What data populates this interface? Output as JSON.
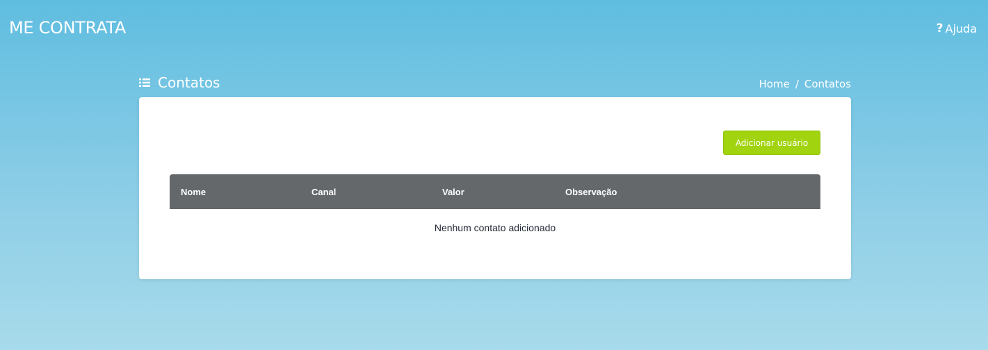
{
  "header": {
    "brand": "ME CONTRATA",
    "help_label": "Ajuda",
    "help_icon": "question-icon"
  },
  "page": {
    "title": "Contatos",
    "title_icon": "list-icon",
    "breadcrumb": [
      "Home",
      "Contatos"
    ],
    "breadcrumb_separator": "/"
  },
  "actions": {
    "add_label": "Adicionar usuário"
  },
  "table": {
    "columns": [
      "Nome",
      "Canal",
      "Valor",
      "Observação"
    ],
    "rows": [],
    "empty_message": "Nenhum contato adicionado"
  },
  "colors": {
    "background_top": "#5fbde0",
    "background_bottom": "#a8dbeb",
    "accent_button": "#a2d30f",
    "table_header": "#65686b"
  }
}
